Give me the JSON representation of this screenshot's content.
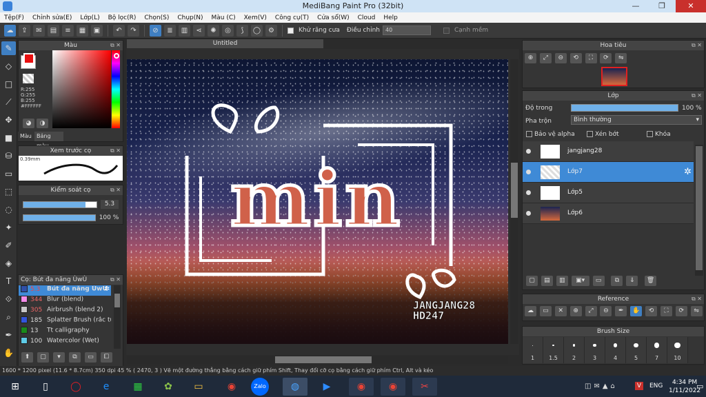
{
  "window": {
    "title": "MediBang Paint Pro (32bit)",
    "min": "—",
    "max": "❐",
    "close": "✕"
  },
  "menu": [
    "Tệp(F)",
    "Chỉnh sửa(E)",
    "Lớp(L)",
    "Bộ lọc(R)",
    "Chọn(S)",
    "Chụp(N)",
    "Màu (C)",
    "Xem(V)",
    "Công cụ(T)",
    "Cửa sổ(W)",
    "Cloud",
    "Help"
  ],
  "toolbar": {
    "antialias_label": "Khử răng cưa",
    "adjust_label": "Điều chỉnh",
    "adjust_value": "40",
    "snap_label": "Cạnh mềm"
  },
  "color_panel": {
    "title": "Màu",
    "r": "R:255",
    "g": "G:255",
    "b": "B:255",
    "hex": "#FFFFFF",
    "tab_color": "Màu",
    "tab_palette": "Bảng màu"
  },
  "brush_preview": {
    "title": "Xem trước cọ",
    "size": "0.39mm"
  },
  "brush_control": {
    "title": "Kiểm soát cọ",
    "size_value": "5.3",
    "opacity_value": "100 %",
    "size_level": 0.85,
    "opacity_level": 1.0
  },
  "brush_list": {
    "title": "Cọ: Bút đa năng ÙwÙ",
    "items": [
      {
        "size": "5.3",
        "name": "Bút đa năng ÙwÙ",
        "color": "#2f4fa8"
      },
      {
        "size": "344",
        "name": "Blur (blend)",
        "color": "#f48be8"
      },
      {
        "size": "305",
        "name": "Airbrush (blend 2)",
        "color": "#c8c8c8"
      },
      {
        "size": "185",
        "name": "Splatter Brush (rắc tuy",
        "color": "#3355dd"
      },
      {
        "size": "13",
        "name": "Tt calligraphy",
        "color": "#1a8a1a"
      },
      {
        "size": "100",
        "name": "Watercolor (Wet)",
        "color": "#5ecbe6"
      }
    ]
  },
  "canvas": {
    "tab": "Untitled",
    "art_title": "min",
    "signature_1": "JANGJANG28",
    "signature_2": "HD247"
  },
  "navigator": {
    "title": "Hoa tiêu"
  },
  "layers": {
    "title": "Lớp",
    "opacity_label": "Độ trong",
    "opacity_value": "100 %",
    "opacity_level": 1.0,
    "blend_label": "Pha trộn",
    "blend_value": "Bình thường",
    "protect_alpha": "Bảo vệ alpha",
    "clipping": "Xén bớt",
    "lock": "Khóa",
    "items": [
      {
        "name": "jangjang28"
      },
      {
        "name": "Lớp7"
      },
      {
        "name": "Lớp5"
      },
      {
        "name": "Lớp6"
      }
    ]
  },
  "reference": {
    "title": "Reference"
  },
  "brush_size": {
    "title": "Brush Size",
    "sizes": [
      "1",
      "1.5",
      "2",
      "3",
      "4",
      "5",
      "7",
      "10"
    ]
  },
  "status": {
    "text": "1600 * 1200 pixel   (11.6 * 8.7cm)   350 dpi   45 %   ( 2470, 3 )   Vẽ một đường thẳng bằng cách giữ phím Shift, Thay đổi cỡ cọ bằng cách giữ phím Ctrl, Alt và kéo"
  },
  "taskbar": {
    "lang": "ENG",
    "time": "4:34 PM",
    "date": "1/11/2022",
    "zalo": "Zalo"
  }
}
